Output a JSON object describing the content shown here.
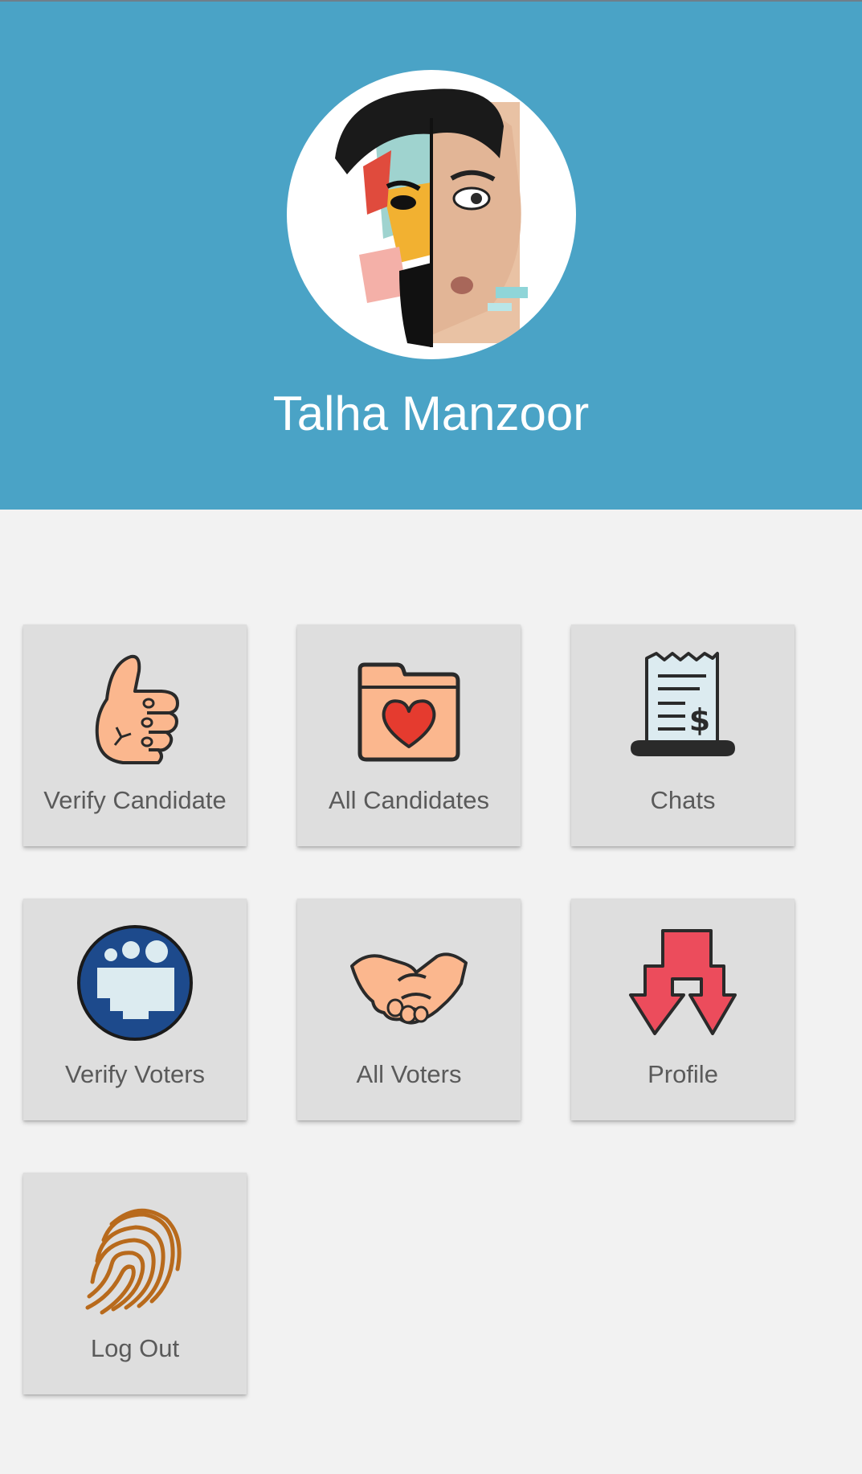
{
  "user": {
    "name": "Talha Manzoor"
  },
  "menu": {
    "items": [
      {
        "label": "Verify Candidate",
        "icon": "thumbs-up-icon"
      },
      {
        "label": "All Candidates",
        "icon": "folder-heart-icon"
      },
      {
        "label": "Chats",
        "icon": "receipt-icon"
      },
      {
        "label": "Verify Voters",
        "icon": "people-circle-icon"
      },
      {
        "label": "All Voters",
        "icon": "handshake-icon"
      },
      {
        "label": "Profile",
        "icon": "split-arrows-icon"
      },
      {
        "label": "Log Out",
        "icon": "fingerprint-icon"
      }
    ]
  },
  "colors": {
    "header": "#4aa3c6",
    "background": "#f2f2f2",
    "tile": "#dedede",
    "label": "#5a5a5a"
  }
}
